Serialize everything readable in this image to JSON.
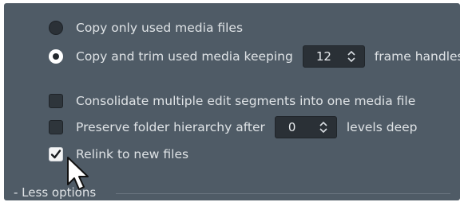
{
  "options": {
    "copy_only_label": "Copy only used media files",
    "copy_trim_label": "Copy and trim used media keeping",
    "handles_value": "12",
    "handles_suffix": "frame handles",
    "consolidate_label": "Consolidate multiple edit segments into one media file",
    "preserve_label": "Preserve folder hierarchy after",
    "levels_value": "0",
    "levels_suffix": "levels deep",
    "relink_label": "Relink to new files"
  },
  "state": {
    "copy_mode": "copy_and_trim",
    "consolidate_checked": false,
    "preserve_checked": false,
    "relink_checked": true
  },
  "footer": {
    "less_options_label": "- Less options"
  }
}
